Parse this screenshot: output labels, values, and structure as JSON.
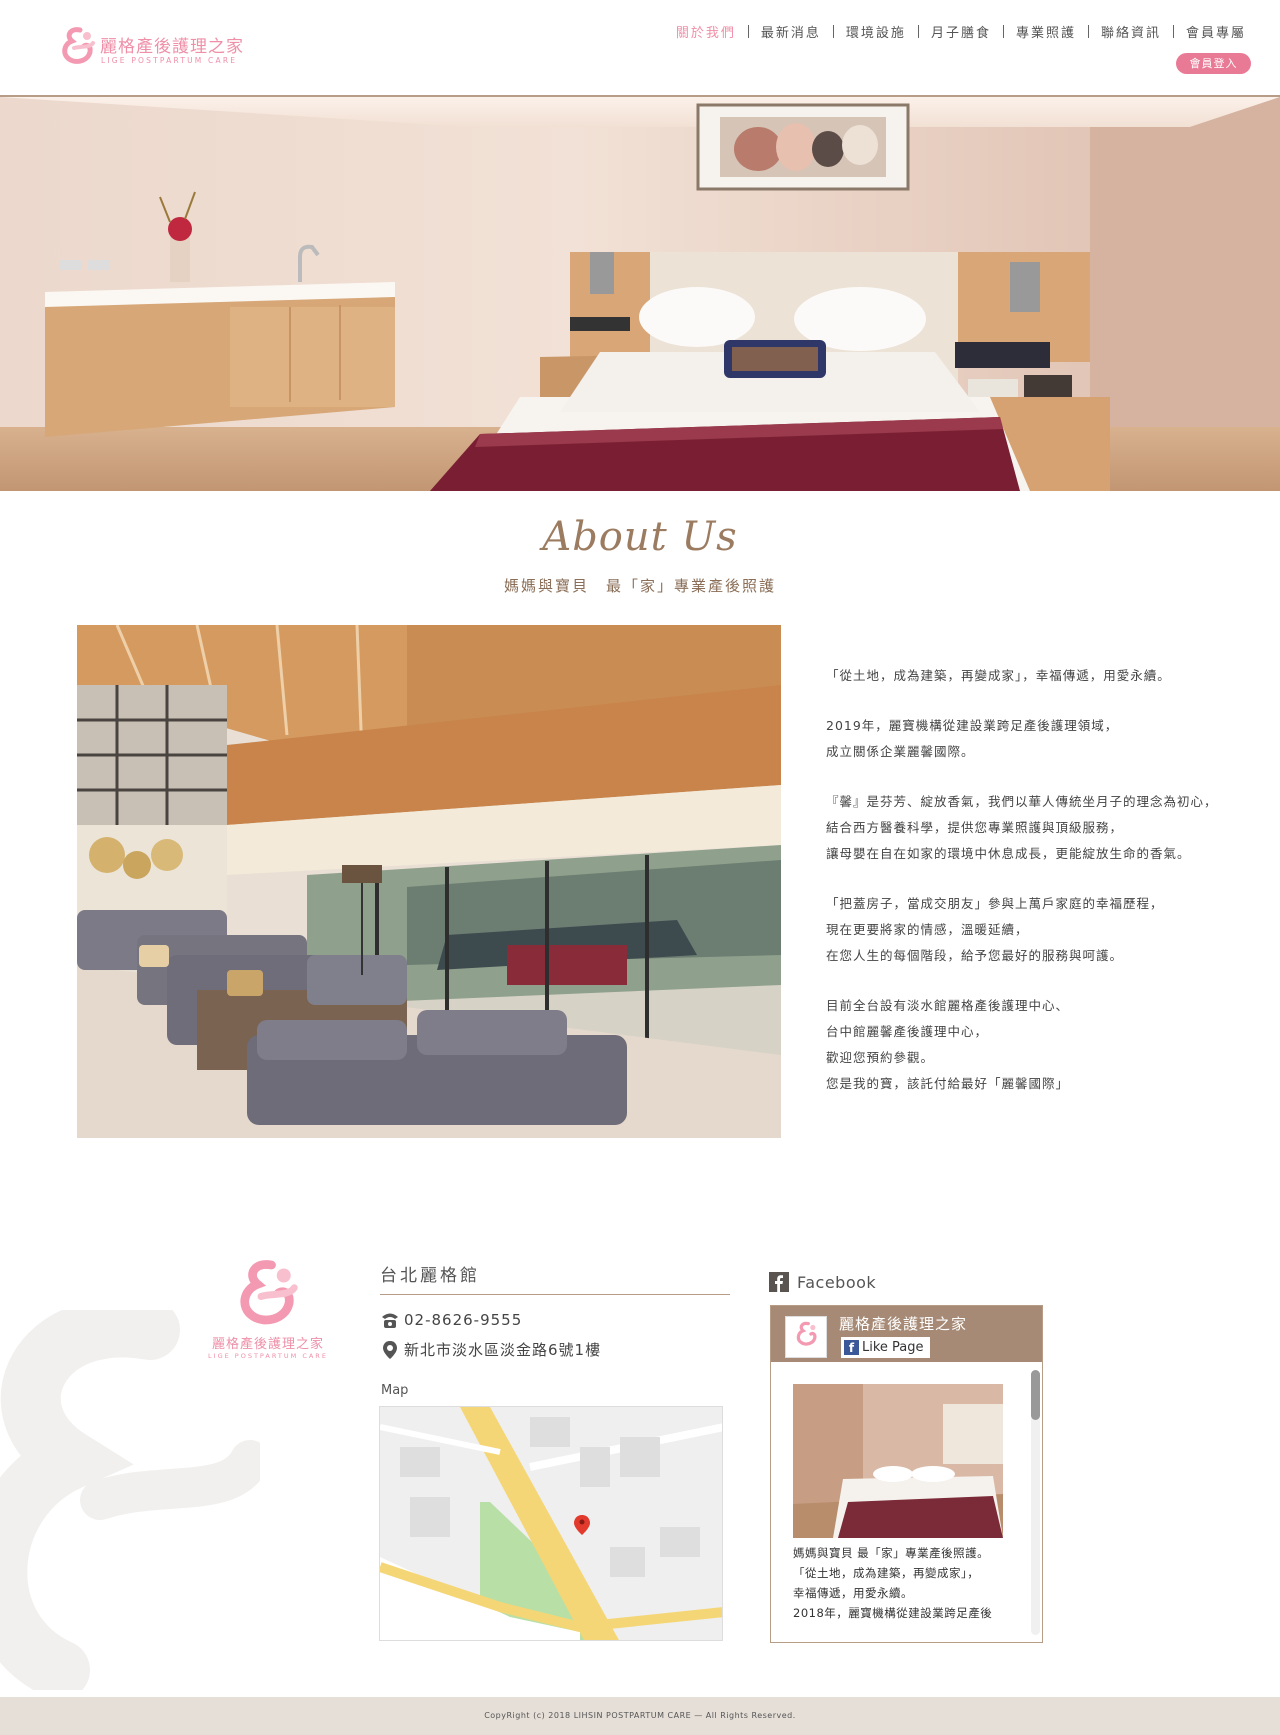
{
  "brand": {
    "name": "麗格產後護理之家",
    "subtitle": "LIGE POSTPARTUM CARE",
    "accent_color": "#ef8fa8",
    "bronze_color": "#b79d85"
  },
  "nav": {
    "items": [
      {
        "label": "關於我們",
        "active": true
      },
      {
        "label": "最新消息",
        "active": false
      },
      {
        "label": "環境設施",
        "active": false
      },
      {
        "label": "月子膳食",
        "active": false
      },
      {
        "label": "專業照護",
        "active": false
      },
      {
        "label": "聯絡資訊",
        "active": false
      },
      {
        "label": "會員專屬",
        "active": false
      }
    ],
    "member_login": "會員登入"
  },
  "about": {
    "title": "About Us",
    "subtitle": "媽媽與寶貝　最「家」專業產後照護",
    "paragraphs": [
      [
        "「從土地，成為建築，再變成家」，幸福傳遞，用愛永續。"
      ],
      [
        "2019年，麗寶機構從建設業跨足產後護理領域，",
        "成立關係企業麗馨國際。"
      ],
      [
        "『馨』是芬芳、綻放香氣，我們以華人傳統坐月子的理念為初心，",
        "結合西方醫養科學，提供您專業照護與頂級服務，",
        "讓母嬰在自在如家的環境中休息成長，更能綻放生命的香氣。"
      ],
      [
        "「把蓋房子，當成交朋友」參與上萬戶家庭的幸福歷程，",
        "現在更要將家的情感，溫暖延續，",
        "在您人生的每個階段，給予您最好的服務與呵護。"
      ],
      [
        "目前全台設有淡水館麗格產後護理中心、",
        "台中館麗馨產後護理中心，",
        "歡迎您預約參觀。",
        "您是我的寶，該託付給最好「麗馨國際」"
      ]
    ]
  },
  "branch": {
    "title": "台北麗格館",
    "phone": "02-8626-9555",
    "address": "新北市淡水區淡金路6號1樓",
    "map_label": "Map"
  },
  "facebook": {
    "label": "Facebook",
    "page_name": "麗格產後護理之家",
    "like_label": "Like Page",
    "post_lines": [
      "媽媽與寶貝 最「家」專業產後照護。",
      "「從土地，成為建築，再變成家」，",
      "幸福傳遞，用愛永續。",
      "2018年，麗寶機構從建設業跨足產後"
    ]
  },
  "footer": {
    "copyright": "CopyRight (c) 2018  LIHSIN POSTPARTUM CARE — All Rights Reserved."
  }
}
